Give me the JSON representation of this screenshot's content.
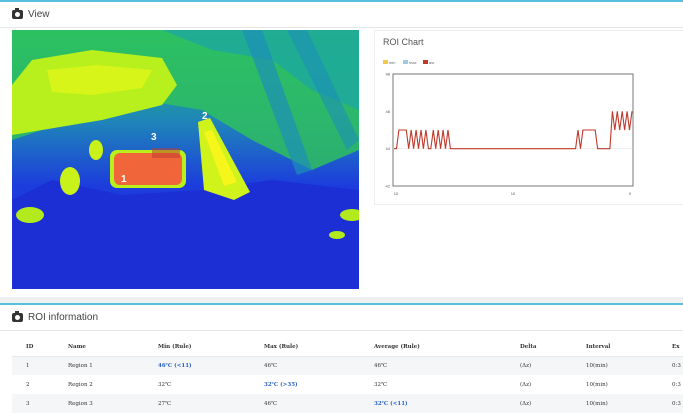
{
  "view": {
    "title": "View",
    "roi_labels": [
      "1",
      "2",
      "3"
    ]
  },
  "roi_chart": {
    "title": "ROI Chart",
    "legend": [
      {
        "label": "min",
        "color": "#f2c94c"
      },
      {
        "label": "max",
        "color": "#9ecae1"
      },
      {
        "label": "avr",
        "color": "#c0392b"
      }
    ]
  },
  "chart_data": {
    "type": "line",
    "title": "ROI Chart",
    "x_ticks": [
      "10",
      "10",
      "0"
    ],
    "y_ticks": [
      "42",
      "44",
      "46",
      "48"
    ],
    "ylim": [
      42,
      48
    ],
    "series": [
      {
        "name": "avr",
        "color": "#c0392b",
        "values": [
          44,
          44,
          45,
          45,
          45,
          45,
          44,
          45,
          44,
          45,
          44,
          45,
          44,
          45,
          44,
          44,
          45,
          44,
          45,
          44,
          45,
          44,
          45,
          44,
          44,
          44,
          44,
          44,
          44,
          44,
          44,
          44,
          44,
          44,
          44,
          44,
          44,
          44,
          44,
          44,
          44,
          44,
          44,
          44,
          44,
          44,
          44,
          44,
          44,
          44,
          44,
          44,
          44,
          44,
          44,
          44,
          44,
          44,
          44,
          44,
          44,
          44,
          44,
          44,
          44,
          44,
          44,
          44,
          44,
          44,
          44,
          44,
          44,
          44,
          44,
          45,
          44,
          45,
          45,
          45,
          45,
          45,
          45,
          44,
          44,
          44,
          44,
          44,
          44,
          46,
          45,
          46,
          45,
          46,
          45,
          46,
          45,
          46
        ]
      }
    ]
  },
  "roi_info": {
    "title": "ROI information",
    "columns": [
      "ID",
      "Name",
      "Min (Rule)",
      "Max (Rule)",
      "Average (Rule)",
      "Delta",
      "Interval",
      "Ex"
    ],
    "rows": [
      {
        "id": "1",
        "name": "Region 1",
        "min": "46℃ (<11)",
        "max": "46℃",
        "avg": "46℃",
        "delta": "(Δz)",
        "interval": "10(min)",
        "ex": "0:3"
      },
      {
        "id": "2",
        "name": "Region 2",
        "min": "32℃",
        "max": "32℃ (>35)",
        "avg": "32℃",
        "delta": "(Δz)",
        "interval": "10(min)",
        "ex": "0:3"
      },
      {
        "id": "3",
        "name": "Region 3",
        "min": "27℃",
        "max": "46℃",
        "avg": "32℃ (<11)",
        "delta": "(Δz)",
        "interval": "10(min)",
        "ex": "0:3"
      }
    ]
  }
}
